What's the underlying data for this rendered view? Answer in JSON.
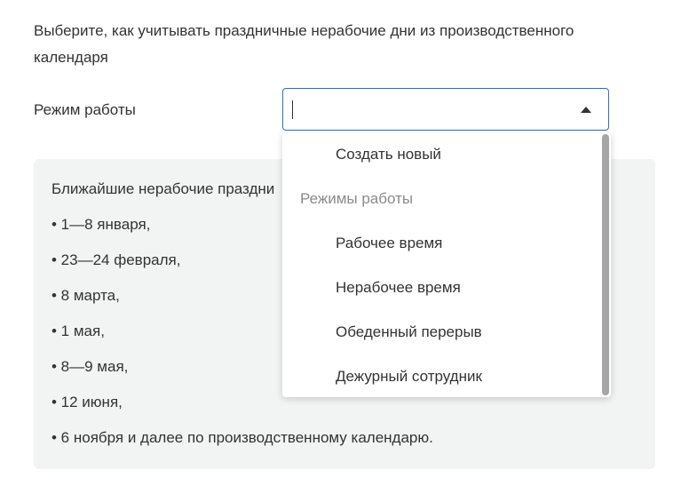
{
  "intro": "Выберите, как учитывать праздничные нерабочие дни из производственного календаря",
  "field": {
    "label": "Режим работы",
    "value": ""
  },
  "panel": {
    "title": "Ближайшие нерабочие праздни",
    "holidays": [
      "• 1—8 января,",
      "• 23—24 февраля,",
      "• 8 марта,",
      "• 1 мая,",
      "• 8—9 мая,",
      "• 12 июня,",
      "• 6 ноября и далее по производственному календарю."
    ]
  },
  "dropdown": {
    "create_new": "Создать новый",
    "group_label": "Режимы работы",
    "options": [
      "Рабочее время",
      "Нерабочее время",
      "Обеденный перерыв",
      "Дежурный сотрудник"
    ]
  },
  "colors": {
    "accent_border": "#2f6fc0",
    "panel_bg": "#f2f3f3",
    "group_text": "#8a8a8a"
  },
  "icons": {
    "dropdown_toggle": "triangle-up-icon"
  }
}
